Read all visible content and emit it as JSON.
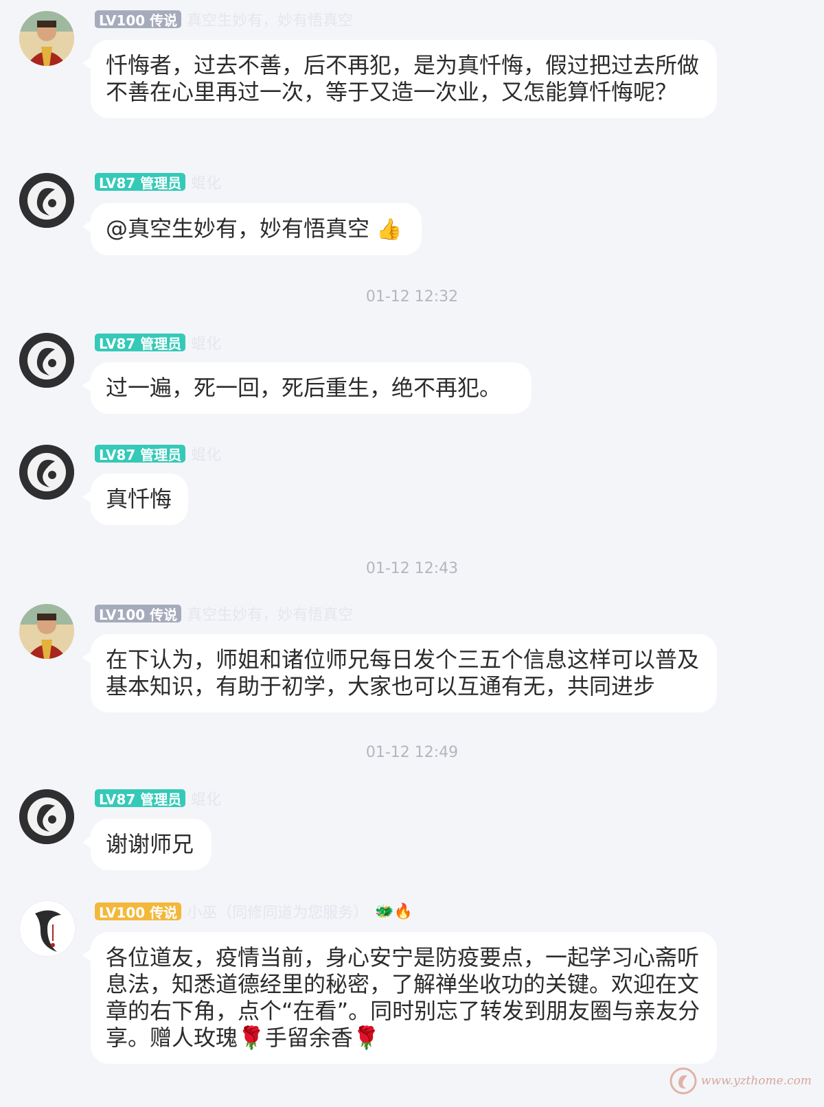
{
  "messages": [
    {
      "badge": "LV100 传说",
      "nick": "真空生妙有，妙有悟真空",
      "text": "忏悔者，过去不善，后不再犯，是为真忏悔，假过把过去所做不善在心里再过一次，等于又造一次业，又怎能算忏悔呢？"
    },
    {
      "badge": "LV87 管理员",
      "nick": "蜫化",
      "text": "@真空生妙有，妙有悟真空",
      "emoji": "👍"
    },
    {
      "badge": "LV87 管理员",
      "nick": "蜫化",
      "text": "过一遍，死一回，死后重生，绝不再犯。"
    },
    {
      "badge": "LV87 管理员",
      "nick": "蜫化",
      "text": "真忏悔"
    },
    {
      "badge": "LV100 传说",
      "nick": "真空生妙有，妙有悟真空",
      "text": "在下认为，师姐和诸位师兄每日发个三五个信息这样可以普及基本知识，有助于初学，大家也可以互通有无，共同进步"
    },
    {
      "badge": "LV87 管理员",
      "nick": "蜫化",
      "text": "谢谢师兄"
    },
    {
      "badge": "LV100 传说",
      "nick": "小巫（同修同道为您服务）",
      "deco": "🐲🔥",
      "text": "各位道友，疫情当前，身心安宁是防疫要点，一起学习心斋听息法，知悉道德经里的秘密，了解禅坐收功的关键。欢迎在文章的右下角，点个“在看”。同时别忘了转发到朋友圈与亲友分享。赠人玫瑰🌹手留余香🌹"
    }
  ],
  "timestamps": [
    "01-12 12:32",
    "01-12 12:43",
    "01-12 12:49"
  ],
  "watermark": "www.yzthome.com",
  "colors": {
    "badge_gray": "#a6abbc",
    "badge_teal": "#35c9b8",
    "badge_gold": "#f3b83b",
    "background": "#f4f5f9"
  }
}
